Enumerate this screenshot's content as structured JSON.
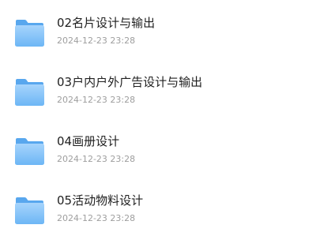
{
  "files": [
    {
      "name": "02名片设计与输出",
      "date": "2024-12-23 23:28",
      "icon": "folder-icon"
    },
    {
      "name": "03户内户外广告设计与输出",
      "date": "2024-12-23 23:28",
      "icon": "folder-icon"
    },
    {
      "name": "04画册设计",
      "date": "2024-12-23 23:28",
      "icon": "folder-icon"
    },
    {
      "name": "05活动物料设计",
      "date": "2024-12-23 23:28",
      "icon": "folder-icon"
    }
  ],
  "colors": {
    "folder_back": "#58a7ee",
    "folder_front_top": "#9fd0fb",
    "folder_front_bottom": "#6db6f5",
    "name_text": "#1f1f1f",
    "date_text": "#9e9e9e"
  }
}
